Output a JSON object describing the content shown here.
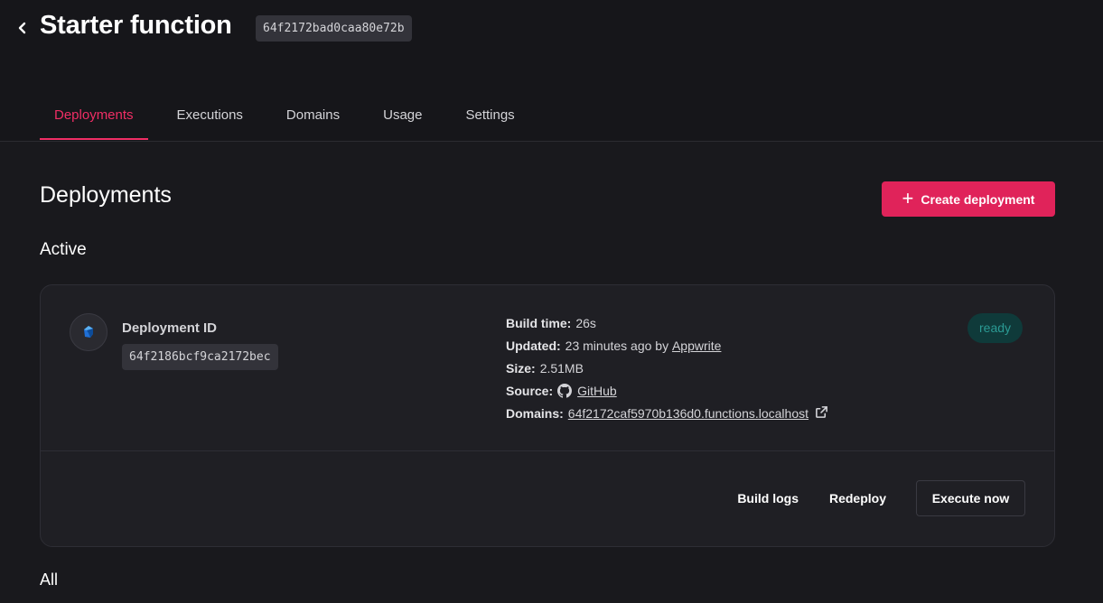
{
  "header": {
    "title": "Starter function",
    "function_id": "64f2172bad0caa80e72b"
  },
  "tabs": [
    {
      "label": "Deployments",
      "active": true
    },
    {
      "label": "Executions",
      "active": false
    },
    {
      "label": "Domains",
      "active": false
    },
    {
      "label": "Usage",
      "active": false
    },
    {
      "label": "Settings",
      "active": false
    }
  ],
  "main": {
    "section_title": "Deployments",
    "create_button_label": "Create deployment",
    "active_title": "Active",
    "all_title": "All"
  },
  "deployment": {
    "id_label": "Deployment ID",
    "id": "64f2186bcf9ca2172bec",
    "status": "ready",
    "build_time_key": "Build time:",
    "build_time": "26s",
    "updated_key": "Updated:",
    "updated": "23 minutes ago by",
    "updated_by": "Appwrite",
    "size_key": "Size:",
    "size": "2.51MB",
    "source_key": "Source:",
    "source": "GitHub",
    "domains_key": "Domains:",
    "domain": "64f2172caf5970b136d0.functions.localhost",
    "actions": {
      "build_logs": "Build logs",
      "redeploy": "Redeploy",
      "execute": "Execute now"
    }
  },
  "colors": {
    "accent": "#e0235a",
    "status_ready_bg": "#0f3a3a",
    "status_ready_text": "#2b9a94",
    "background": "#19191d"
  },
  "icons": [
    "chevron-left-icon",
    "plus-icon",
    "dart-runtime-icon",
    "github-icon",
    "external-link-icon"
  ]
}
